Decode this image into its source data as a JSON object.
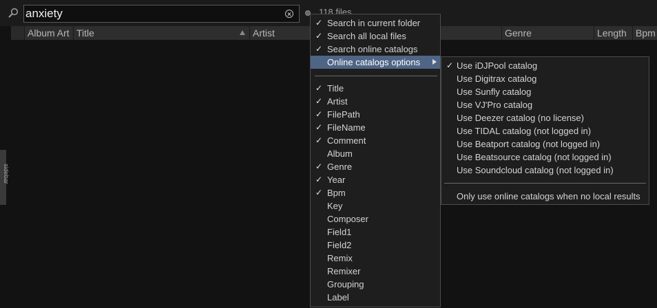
{
  "search": {
    "query": "anxiety",
    "file_count": "118 files"
  },
  "columns": [
    "Album Art",
    "Title",
    "Artist",
    "Genre",
    "Length",
    "Bpm"
  ],
  "side_tab": {
    "label": "sidebar"
  },
  "main_menu": {
    "scope_items": [
      {
        "label": "Search in current folder",
        "checked": true
      },
      {
        "label": "Search all local files",
        "checked": true
      },
      {
        "label": "Search online catalogs",
        "checked": true
      }
    ],
    "submenu_item": {
      "label": "Online catalogs options",
      "highlighted": true
    },
    "field_items": [
      {
        "label": "Title",
        "checked": true
      },
      {
        "label": "Artist",
        "checked": true
      },
      {
        "label": "FilePath",
        "checked": true
      },
      {
        "label": "FileName",
        "checked": true
      },
      {
        "label": "Comment",
        "checked": true
      },
      {
        "label": "Album",
        "checked": false
      },
      {
        "label": "Genre",
        "checked": true
      },
      {
        "label": "Year",
        "checked": true
      },
      {
        "label": "Bpm",
        "checked": true
      },
      {
        "label": "Key",
        "checked": false
      },
      {
        "label": "Composer",
        "checked": false
      },
      {
        "label": "Field1",
        "checked": false
      },
      {
        "label": "Field2",
        "checked": false
      },
      {
        "label": "Remix",
        "checked": false
      },
      {
        "label": "Remixer",
        "checked": false
      },
      {
        "label": "Grouping",
        "checked": false
      },
      {
        "label": "Label",
        "checked": false
      }
    ]
  },
  "sub_menu": {
    "catalogs": [
      {
        "label": "Use iDJPool catalog",
        "checked": true
      },
      {
        "label": "Use Digitrax catalog",
        "checked": false
      },
      {
        "label": "Use Sunfly catalog",
        "checked": false
      },
      {
        "label": "Use VJ'Pro catalog",
        "checked": false
      },
      {
        "label": "Use Deezer catalog (no license)",
        "checked": false
      },
      {
        "label": "Use TIDAL catalog (not logged in)",
        "checked": false
      },
      {
        "label": "Use Beatport catalog (not logged in)",
        "checked": false
      },
      {
        "label": "Use Beatsource catalog (not logged in)",
        "checked": false
      },
      {
        "label": "Use Soundcloud catalog (not logged in)",
        "checked": false
      }
    ],
    "only_online_when_no_local": {
      "label": "Only use online catalogs when no local results",
      "checked": false
    }
  },
  "check_glyph": "✓",
  "colors": {
    "highlight": "#4f6586",
    "menu_bg": "#1e1e1e",
    "header_bg": "#2e2e2e"
  },
  "icons": {
    "search": "magnifier-icon",
    "clear": "clear-icon",
    "options": "options-dot-icon",
    "submenu": "chevron-right-icon"
  }
}
